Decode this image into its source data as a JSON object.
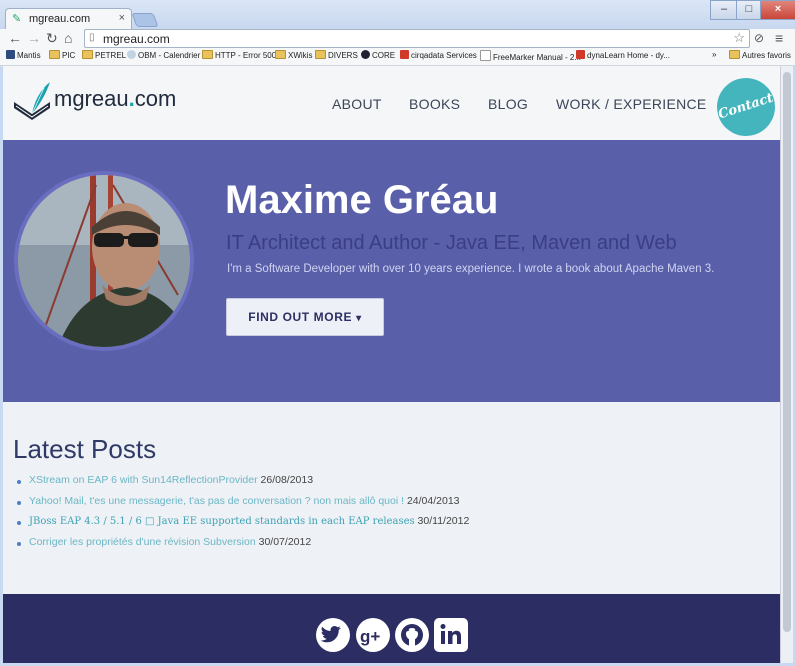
{
  "browser": {
    "tab_title": "mgreau.com",
    "tab_close": "×",
    "url": "mgreau.com",
    "window_buttons": {
      "min": "–",
      "max": "□",
      "close": "×"
    },
    "bookmarks": [
      "Mantis",
      "PIC",
      "PETREL",
      "OBM - Calendrier",
      "HTTP - Error 500",
      "XWikis",
      "DIVERS",
      "CORE",
      "cirqadata Services",
      "FreeMarker Manual - 2...",
      "dynaLearn Home - dy...",
      "»",
      "Autres favoris"
    ]
  },
  "site": {
    "logo_text_main": "mgreau",
    "logo_dot": ".",
    "logo_text_tld": "com",
    "nav": [
      "ABOUT",
      "BOOKS",
      "BLOG",
      "WORK / EXPERIENCE"
    ],
    "contact_label": "Contact"
  },
  "hero": {
    "name": "Maxime Gréau",
    "title": "IT Architect and Author - Java EE, Maven and Web",
    "bio": "I'm a Software Developer with over 10 years experience. I wrote a book about Apache Maven 3.",
    "cta_label": "FIND OUT MORE",
    "cta_chevron": "▾"
  },
  "latest_posts": {
    "heading": "Latest Posts",
    "items": [
      {
        "title": "XStream on EAP 6 with Sun14ReflectionProvider",
        "date": " 26/08/2013"
      },
      {
        "title": "Yahoo! Mail, t'es une messagerie, t'as pas de conversation ? non mais allô quoi !",
        "date": " 24/04/2013"
      },
      {
        "title": "JBoss EAP 4.3 / 5.1 / 6 □ Java EE supported standards in each EAP releases",
        "date": "   30/11/2012"
      },
      {
        "title": "Corriger les propriétés d'une révision Subversion",
        "date": " 30/07/2012"
      }
    ]
  },
  "footer": {
    "social": [
      "twitter-icon",
      "google-plus-icon",
      "github-icon",
      "linkedin-icon"
    ]
  },
  "colors": {
    "hero_bg": "#5a5fa9",
    "footer_bg": "#2c2d62",
    "accent": "#45b5bd"
  }
}
